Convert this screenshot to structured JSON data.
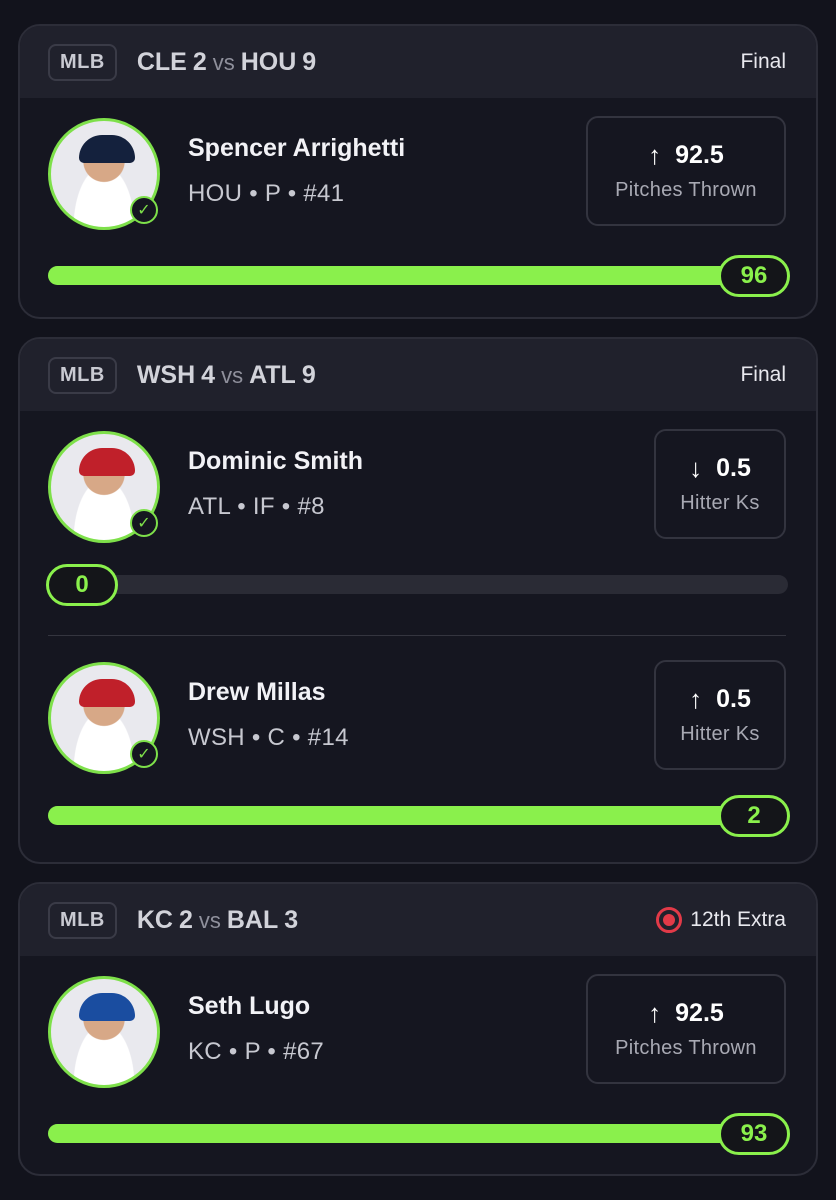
{
  "cards": [
    {
      "league": "MLB",
      "away_team": "CLE",
      "away_score": "2",
      "vs": "vs",
      "home_team": "HOU",
      "home_score": "9",
      "status": "Final",
      "players": [
        {
          "name": "Spencer Arrighetti",
          "meta": "HOU • P • #41",
          "direction": "↑",
          "line": "92.5",
          "stat": "Pitches Thrown",
          "value": "96",
          "progress_fraction": 1.0
        }
      ]
    },
    {
      "league": "MLB",
      "away_team": "WSH",
      "away_score": "4",
      "vs": "vs",
      "home_team": "ATL",
      "home_score": "9",
      "status": "Final",
      "players": [
        {
          "name": "Dominic Smith",
          "meta": "ATL • IF • #8",
          "direction": "↓",
          "line": "0.5",
          "stat": "Hitter Ks",
          "value": "0",
          "progress_fraction": 0.0
        },
        {
          "name": "Drew Millas",
          "meta": "WSH • C • #14",
          "direction": "↑",
          "line": "0.5",
          "stat": "Hitter Ks",
          "value": "2",
          "progress_fraction": 1.0
        }
      ]
    },
    {
      "league": "MLB",
      "away_team": "KC",
      "away_score": "2",
      "vs": "vs",
      "home_team": "BAL",
      "home_score": "3",
      "status": "12th Extra",
      "players": [
        {
          "name": "Seth Lugo",
          "meta": "KC • P • #67",
          "direction": "↑",
          "line": "92.5",
          "stat": "Pitches Thrown",
          "value": "93",
          "progress_fraction": 1.0
        }
      ]
    }
  ],
  "icons": {
    "check": "✓",
    "live": "live-indicator-icon"
  },
  "colors": {
    "accent": "#8af04c",
    "live": "#e23a48",
    "background": "#12131c",
    "card": "#151620",
    "header": "#20212c"
  }
}
